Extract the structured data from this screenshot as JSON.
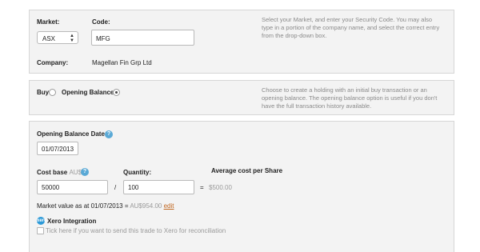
{
  "market_section": {
    "market_label": "Market:",
    "market_value": "ASX",
    "code_label": "Code:",
    "code_value": "MFG",
    "company_label": "Company:",
    "company_value": "Magellan Fin Grp Ltd",
    "help_line1": "Select your Market, and enter your Security Code. You may also",
    "help_line2": "type in a portion of the company name, and select the correct entry",
    "help_line3": "from the drop-down box."
  },
  "type_section": {
    "buy_label": "Buy",
    "opening_label": "Opening Balance",
    "selected": "Opening Balance",
    "help_line1": "Choose to create a holding with an initial buy transaction or an",
    "help_line2": "opening balance. The opening balance option is useful if you don't",
    "help_line3": "have the full transaction history available."
  },
  "balance_section": {
    "date_label": "Opening Balance Date:",
    "date_value": "01/07/2013",
    "cost_label": "Cost base",
    "cost_currency": "AU$",
    "cost_value": "50000",
    "divide_symbol": "/",
    "quantity_label": "Quantity:",
    "quantity_value": "100",
    "equals_symbol": "=",
    "avg_label": "Average cost per Share",
    "avg_value": "$500.00",
    "market_value_prefix": "Market value as at 01/07/2013 = ",
    "market_value_amount": "AU$954.00",
    "edit_link": "edit",
    "xero_title": "Xero Integration",
    "xero_checkbox_label": "Tick here if you want to send this trade to Xero for reconciliation",
    "xero_checked": false
  },
  "icons": {
    "help": "question-icon",
    "xero": "xero-icon",
    "select_arrows": "updown-arrows-icon"
  },
  "colors": {
    "panel_bg": "#f3f3f3",
    "help_icon": "#5aa9d6",
    "link": "#c0661f"
  }
}
